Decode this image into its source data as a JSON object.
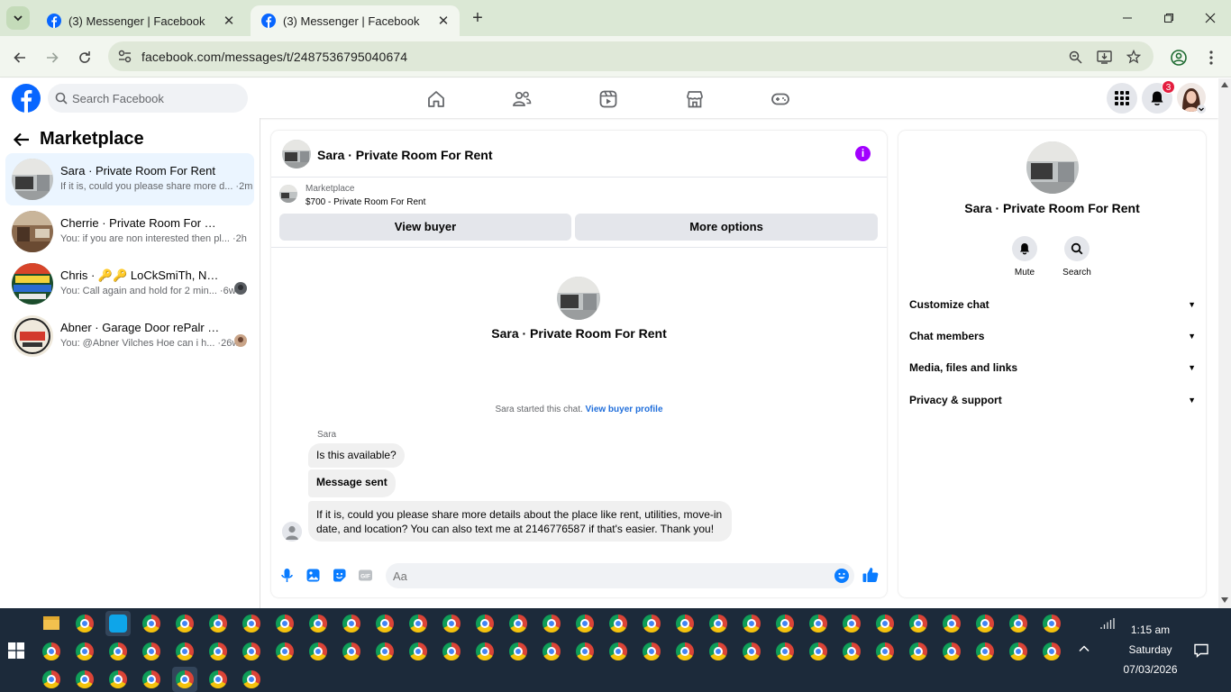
{
  "browser": {
    "tabs": [
      {
        "title": "(3) Messenger | Facebook",
        "active": false
      },
      {
        "title": "(3) Messenger | Facebook",
        "active": true
      }
    ],
    "close_glyph": "✕",
    "new_tab_glyph": "+",
    "url": "facebook.com/messages/t/2487536795040674",
    "window_controls": [
      "minimize-icon",
      "restore-icon",
      "close-icon"
    ]
  },
  "facebook": {
    "search_placeholder": "Search Facebook",
    "nav_icons": [
      "home-icon",
      "friends-icon",
      "video-icon",
      "marketplace-icon",
      "gaming-icon"
    ],
    "notification_count": "3"
  },
  "chat_list": {
    "heading": "Marketplace",
    "items": [
      {
        "name": "Sara · Private Room For Rent",
        "preview": "If it is, could you please share more d... ·2m",
        "active": true
      },
      {
        "name": "Cherrie · Private Room For Rent",
        "preview": "You: if you are non interested then pl... ·2h",
        "active": false
      },
      {
        "name": "Chris · 🔑🔑 LoCkSmiTh, NeaR y...",
        "preview": "You: Call again and hold for 2 min... ·6w",
        "active": false
      },
      {
        "name": "Abner · Garage Door rePalr & In...",
        "preview": "You: @Abner Vilches Hoe can i h... ·26w",
        "active": false
      }
    ]
  },
  "conversation": {
    "title": "Sara · Private Room For Rent",
    "info_glyph": "i",
    "marketplace_label": "Marketplace",
    "listing": "$700 - Private Room For Rent",
    "view_buyer_label": "View buyer",
    "more_options_label": "More options",
    "profile_name": "Sara · Private Room For Rent",
    "started_text": "Sara started this chat.",
    "view_buyer_profile": "View buyer profile",
    "sender": "Sara",
    "messages": [
      "Is this available?",
      "Message sent",
      "If it is, could you please share more details about the place like rent, utilities, move-in date, and location? You can also text me at 2146776587 if that's easier. Thank you!"
    ],
    "input_placeholder": "Aa"
  },
  "info_panel": {
    "name": "Sara · Private Room For Rent",
    "actions": [
      {
        "label": "Mute",
        "icon": "bell-icon"
      },
      {
        "label": "Search",
        "icon": "search-icon"
      }
    ],
    "sections": [
      "Customize chat",
      "Chat members",
      "Media, files and links",
      "Privacy & support"
    ],
    "chevron": "▼"
  },
  "taskbar": {
    "time": "1:15 am",
    "day": "Saturday",
    "date": "07/03/2026"
  },
  "colors": {
    "fb_blue": "#0866ff",
    "messenger_purple": "#a200ff",
    "link_blue": "#216fdb",
    "taskbar": "#1c2a3a",
    "active_chat": "#ebf5ff"
  }
}
